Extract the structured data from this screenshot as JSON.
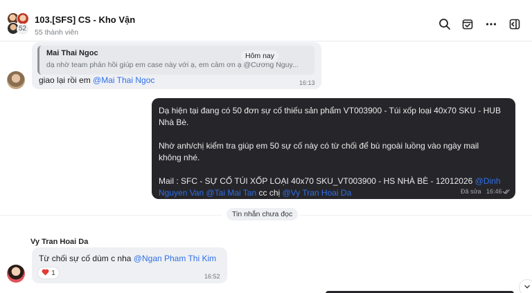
{
  "header": {
    "title": "103.[SFS] CS - Kho Vận",
    "member_count": "55 thành viên",
    "avatar_badge": "52",
    "icons": [
      "search-icon",
      "pin-icon",
      "more-icon",
      "sidebar-toggle-icon"
    ]
  },
  "chat": {
    "date_separator": "Hôm nay",
    "quoted": {
      "name": "Mai Thai Ngoc",
      "text": "dạ nhờ team phản hồi giúp em case này với ạ, em cảm ơn ạ @Cương Nguy..."
    },
    "msg1": {
      "text": "giao lại rồi em ",
      "mention": "@Mai Thai Ngoc",
      "time": "16:13"
    },
    "msg2": {
      "line1": "Dạ hiện tại đang có 50 đơn sự cố thiếu sản phẩm VT003900 - Túi xốp loại 40x70 SKU - HUB",
      "line2": "Nhà Bè.",
      "para2_line1": "Nhờ anh/chị kiểm tra giúp em 50 sự cố này có từ chối để bù  ngoài luồng vào ngày mail",
      "para2_line2": "không nhé.",
      "mail_prefix": "Mail : SFC - SỰ CỐ TÚI XỐP LOẠI 40x70 SKU_VT003900 - HS NHÀ BÈ - 12012026 ",
      "mention_a1": "@Dinh",
      "mention_a2": "Nguyen Van",
      "mention_b": "@Tai Mai Tan",
      "cc_text": " cc chị ",
      "mention_c": "@Vy Tran Hoai Da",
      "edited": "Đã sửa",
      "time": "16:46"
    },
    "unread_label": "Tin nhắn chưa đọc",
    "msg3": {
      "sender": "Vy Tran Hoai Da",
      "text": "Từ chối sự cố dùm c nha ",
      "mention": "@Ngan Pham Thi Kim",
      "reaction_count": "1",
      "time": "16:52"
    }
  },
  "colors": {
    "mention": "#2f6fe8",
    "outgoing_bubble": "#26262a",
    "incoming_bubble": "#eef0f3",
    "reaction_heart": "#e53935"
  }
}
